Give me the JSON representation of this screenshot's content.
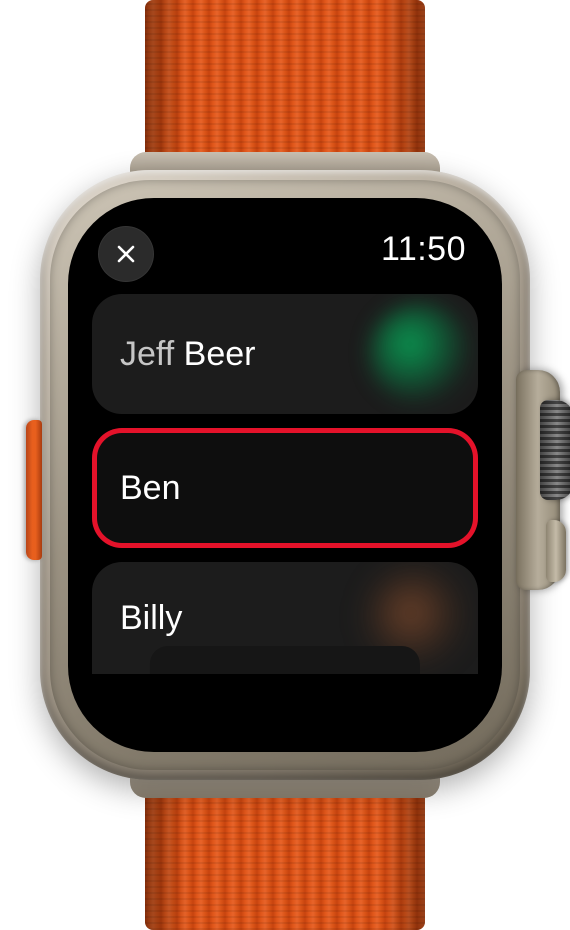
{
  "status": {
    "time": "11:50",
    "close_icon": "close-icon"
  },
  "contacts": [
    {
      "first": "Jeff",
      "last": "Beer",
      "highlighted": false,
      "accent": "green"
    },
    {
      "first": "Ben",
      "last": "",
      "highlighted": true,
      "accent": "none"
    },
    {
      "first": "Billy",
      "last": "",
      "highlighted": false,
      "accent": "orange"
    }
  ],
  "colors": {
    "highlight_ring": "#e4122a",
    "band": "#e0561a"
  }
}
